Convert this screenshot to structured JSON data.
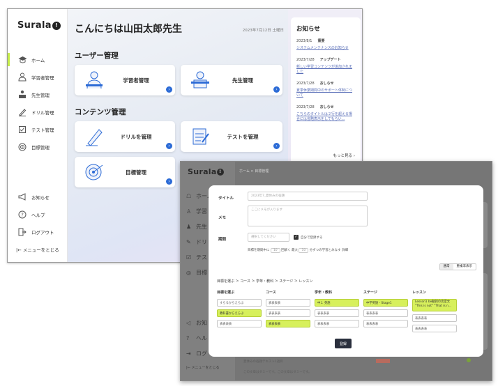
{
  "back_app": {
    "logo": "Surala",
    "logo_mark": "!",
    "greeting": "こんにちは山田太郎先生",
    "date": "2023年7月12日 土曜日",
    "nav_items": [
      {
        "label": "ホーム",
        "icon": "graduation-cap-icon",
        "active": true
      },
      {
        "label": "学習者管理",
        "icon": "student-icon"
      },
      {
        "label": "先生管理",
        "icon": "teacher-icon"
      },
      {
        "label": "ドリル管理",
        "icon": "pencil-icon"
      },
      {
        "label": "テスト管理",
        "icon": "test-icon"
      },
      {
        "label": "目標管理",
        "icon": "target-icon"
      }
    ],
    "bottom_items": [
      {
        "label": "お知らせ",
        "icon": "megaphone-icon"
      },
      {
        "label": "ヘルプ",
        "icon": "help-icon"
      },
      {
        "label": "ログアウト",
        "icon": "logout-icon"
      },
      {
        "label": "|← メニューをとじる",
        "icon": "collapse-icon"
      }
    ],
    "user_section": "ユーザー管理",
    "content_section": "コンテンツ管理",
    "tiles": {
      "learner": "学習者管理",
      "teacher": "先生管理",
      "drill": "ドリルを管理",
      "test": "テストを管理",
      "goal": "目標管理"
    },
    "news": {
      "title": "お知らせ",
      "entries": [
        {
          "date": "2023/8/1",
          "category": "重要",
          "text": "システムメンテナンスのお知らせ"
        },
        {
          "date": "2023/7/28",
          "category": "アップデート",
          "text": "新しい学習コンテンツが追加されました"
        },
        {
          "date": "2023/7/28",
          "category": "おしらせ",
          "text": "夏季休業期間中のサポート体制について"
        },
        {
          "date": "2023/7/28",
          "category": "おしらせ",
          "text": "こちらのタイトルは２行を超える場合には省略表示をしてもらい..."
        }
      ],
      "more": "もっと見る ›"
    }
  },
  "front_app": {
    "logo": "Surala",
    "logo_mark": "!",
    "breadcrumb": "ホーム > 目標管理",
    "nav_labels": [
      "ホーム",
      "学習",
      "先生",
      "ドリ",
      "テス",
      "目標"
    ],
    "bottom_labels": [
      "お知",
      "ヘル",
      "ログ",
      "|← メニューをとじる"
    ],
    "modal": {
      "title_label": "タイトル",
      "title_value": "2023年7_夏休みの宿題",
      "memo_label": "メモ",
      "memo_placeholder": "ここにメモが入ります",
      "period_label": "期間",
      "period_placeholder": "選択してください",
      "checkbox_label": "自分で登録する",
      "checkbox_mark": "✓",
      "rule_text_1": "目標を期間中に",
      "rule_value_1": "10",
      "rule_text_2": "回解く 最大",
      "rule_value_2": "10",
      "rule_text_3": "分ずつの学習とみなす 詳細",
      "toggle": [
        "通常",
        "重複非表示"
      ],
      "crumb": "目標を選ぶ ＞ コース ＞ 学年・教科 ＞ ステージ ＞ レッスン",
      "columns": [
        {
          "header": "目標を選ぶ",
          "cells": [
            {
              "text": "すらるからえらぶ",
              "sel": false
            },
            {
              "text": "教科書からえらぶ",
              "sel": true
            },
            {
              "text": "表表表表",
              "sel": false
            }
          ]
        },
        {
          "header": "コース",
          "cells": [
            {
              "text": "表表表表",
              "sel": false
            },
            {
              "text": "表表表表",
              "sel": false
            },
            {
              "text": "表表表表",
              "sel": true
            }
          ]
        },
        {
          "header": "学年・教科",
          "cells": [
            {
              "text": "中１ 英語",
              "sel": true
            },
            {
              "text": "表表表表",
              "sel": false
            },
            {
              "text": "表表表表",
              "sel": false
            }
          ]
        },
        {
          "header": "ステージ",
          "cells": [
            {
              "text": "中学英語 - Stage1",
              "sel": true
            },
            {
              "text": "表表表表",
              "sel": false
            },
            {
              "text": "表表表表",
              "sel": false
            }
          ]
        },
        {
          "header": "レッスン",
          "cells": [
            {
              "text": "Lesson1 be動詞の否定文 \"This is not\" \"That is n...",
              "sel": true
            },
            {
              "text": "表表表表",
              "sel": false
            },
            {
              "text": "表表表表",
              "sel": false
            }
          ]
        }
      ],
      "submit": "登録"
    },
    "background_rows": [
      "夏休みの宿題テキスト1週目",
      "この文章はダミーです。この文章はダミーです。"
    ]
  },
  "colors": {
    "accent_green": "#c7ef48",
    "link_blue": "#2c6bd6",
    "selected_cell": "#d7f05c",
    "dark_button": "#2a2f3d"
  }
}
